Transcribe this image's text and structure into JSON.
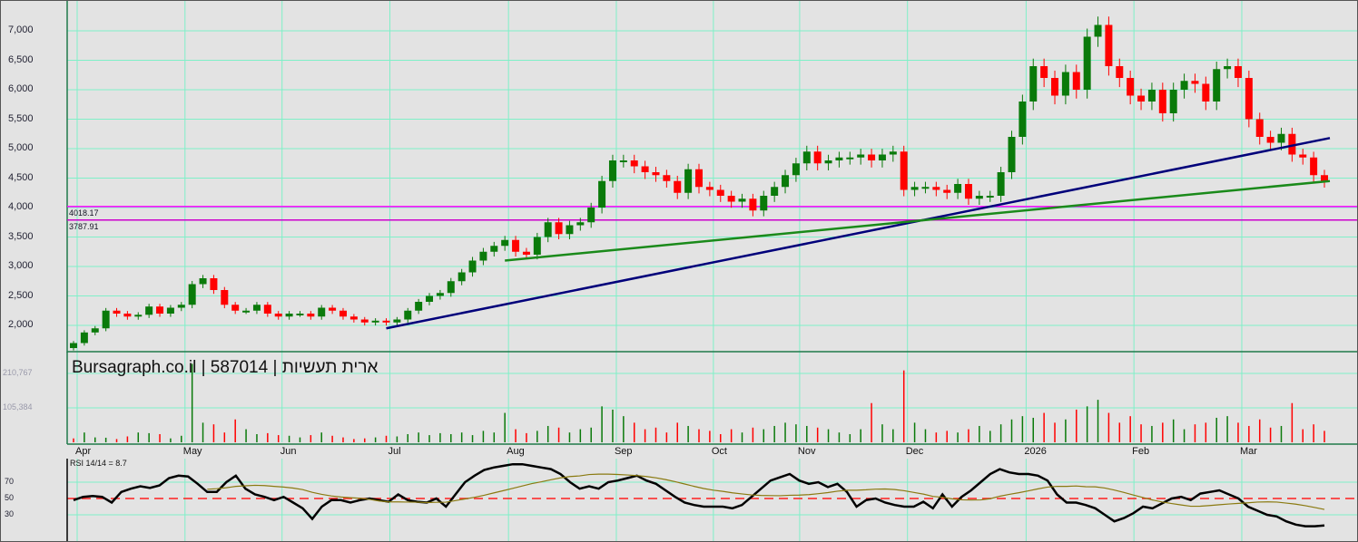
{
  "title": "Bursagraph.co.il | 587014 | ארית תעשיות",
  "chart_data": {
    "type": "candlestick",
    "price_axis": {
      "ticks": [
        "7,000",
        "6,500",
        "6,000",
        "5,500",
        "5,000",
        "4,500",
        "4,000",
        "3,500",
        "3,000",
        "2,500",
        "2,000"
      ],
      "values": [
        7000,
        6500,
        6000,
        5500,
        5000,
        4500,
        4000,
        3500,
        3000,
        2500,
        2000
      ]
    },
    "levels": [
      {
        "label": "4018.17",
        "value": 4018.17,
        "color": "#ff00ff"
      },
      {
        "label": "3787.91",
        "value": 3787.91,
        "color": "#cc00cc"
      }
    ],
    "months": [
      "Apr",
      "May",
      "Jun",
      "Jul",
      "Aug",
      "Sep",
      "Oct",
      "Nov",
      "Dec",
      "2026",
      "Feb",
      "Mar"
    ],
    "month_index": [
      0,
      10,
      19,
      29,
      40,
      50,
      59,
      67,
      77,
      88,
      98,
      108
    ],
    "closes": [
      1700,
      1880,
      1950,
      2250,
      2200,
      2150,
      2180,
      2320,
      2200,
      2300,
      2350,
      2700,
      2800,
      2600,
      2350,
      2250,
      2250,
      2350,
      2200,
      2150,
      2200,
      2200,
      2150,
      2300,
      2250,
      2150,
      2100,
      2050,
      2080,
      2050,
      2100,
      2250,
      2400,
      2500,
      2550,
      2750,
      2900,
      3100,
      3250,
      3350,
      3450,
      3250,
      3200,
      3500,
      3750,
      3550,
      3700,
      3750,
      4000,
      4450,
      4800,
      4800,
      4700,
      4600,
      4550,
      4450,
      4250,
      4650,
      4350,
      4300,
      4200,
      4100,
      4150,
      3950,
      4200,
      4350,
      4550,
      4750,
      4950,
      4750,
      4800,
      4850,
      4850,
      4900,
      4800,
      4900,
      4950,
      4300,
      4350,
      4350,
      4300,
      4250,
      4400,
      4150,
      4200,
      4200,
      4600,
      5200,
      5800,
      6400,
      6200,
      5900,
      6300,
      6000,
      6900,
      7100,
      6400,
      6200,
      5900,
      5800,
      6000,
      5600,
      6000,
      6150,
      6100,
      5800,
      6350,
      6400,
      6200,
      5500,
      5200,
      5100,
      5250,
      4900,
      4850,
      4550,
      4450
    ],
    "trendlines": [
      {
        "color": "#00007a",
        "from": [
          29,
          1950
        ],
        "to": [
          116,
          5180
        ]
      },
      {
        "color": "#1a8a1a",
        "from": [
          40,
          3100
        ],
        "to": [
          116,
          4450
        ]
      }
    ],
    "volume_axis": {
      "ticks": [
        "210,767",
        "105,384"
      ],
      "values": [
        210767,
        105384
      ]
    },
    "volumes": [
      12000,
      30000,
      15000,
      14000,
      10000,
      18000,
      30000,
      28000,
      25000,
      12000,
      20000,
      240000,
      60000,
      55000,
      30000,
      70000,
      40000,
      25000,
      28000,
      22000,
      20000,
      15000,
      22000,
      30000,
      20000,
      15000,
      10000,
      12000,
      15000,
      20000,
      18000,
      25000,
      30000,
      22000,
      28000,
      25000,
      30000,
      22000,
      35000,
      30000,
      90000,
      40000,
      28000,
      35000,
      50000,
      45000,
      30000,
      40000,
      45000,
      110000,
      100000,
      80000,
      60000,
      40000,
      45000,
      30000,
      60000,
      50000,
      40000,
      35000,
      25000,
      40000,
      30000,
      45000,
      40000,
      50000,
      60000,
      55000,
      50000,
      45000,
      40000,
      30000,
      25000,
      40000,
      120000,
      55000,
      40000,
      220000,
      60000,
      40000,
      30000,
      35000,
      30000,
      40000,
      50000,
      35000,
      55000,
      70000,
      80000,
      75000,
      90000,
      60000,
      70000,
      100000,
      110000,
      130000,
      90000,
      60000,
      80000,
      55000,
      50000,
      60000,
      70000,
      40000,
      55000,
      60000,
      75000,
      80000,
      60000,
      50000,
      70000,
      45000,
      50000,
      120000,
      40000,
      55000,
      35000
    ],
    "rsi": {
      "label": "RSI 14/14 = 8.7",
      "ticks": [
        "70",
        "50",
        "30"
      ],
      "levels": [
        70,
        50,
        30
      ],
      "values": [
        48,
        52,
        53,
        52,
        45,
        58,
        62,
        65,
        63,
        66,
        75,
        78,
        77,
        68,
        58,
        58,
        70,
        78,
        62,
        55,
        52,
        48,
        52,
        45,
        38,
        25,
        40,
        48,
        48,
        45,
        48,
        50,
        48,
        46,
        55,
        48,
        46,
        45,
        50,
        40,
        55,
        70,
        78,
        85,
        88,
        90,
        92,
        92,
        90,
        88,
        86,
        80,
        70,
        62,
        65,
        62,
        70,
        72,
        75,
        78,
        72,
        68,
        60,
        52,
        45,
        42,
        40,
        40,
        40,
        38,
        42,
        52,
        62,
        72,
        76,
        80,
        72,
        68,
        70,
        64,
        68,
        58,
        40,
        48,
        50,
        45,
        42,
        40,
        40,
        46,
        38,
        55,
        40,
        52,
        60,
        70,
        80,
        86,
        82,
        80,
        80,
        78,
        72,
        55,
        45,
        45,
        42,
        38,
        30,
        22,
        26,
        32,
        40,
        38,
        44,
        50,
        52,
        48,
        56,
        58,
        60,
        55,
        50,
        40,
        35,
        30,
        28,
        22,
        18,
        16,
        16,
        17
      ]
    }
  }
}
